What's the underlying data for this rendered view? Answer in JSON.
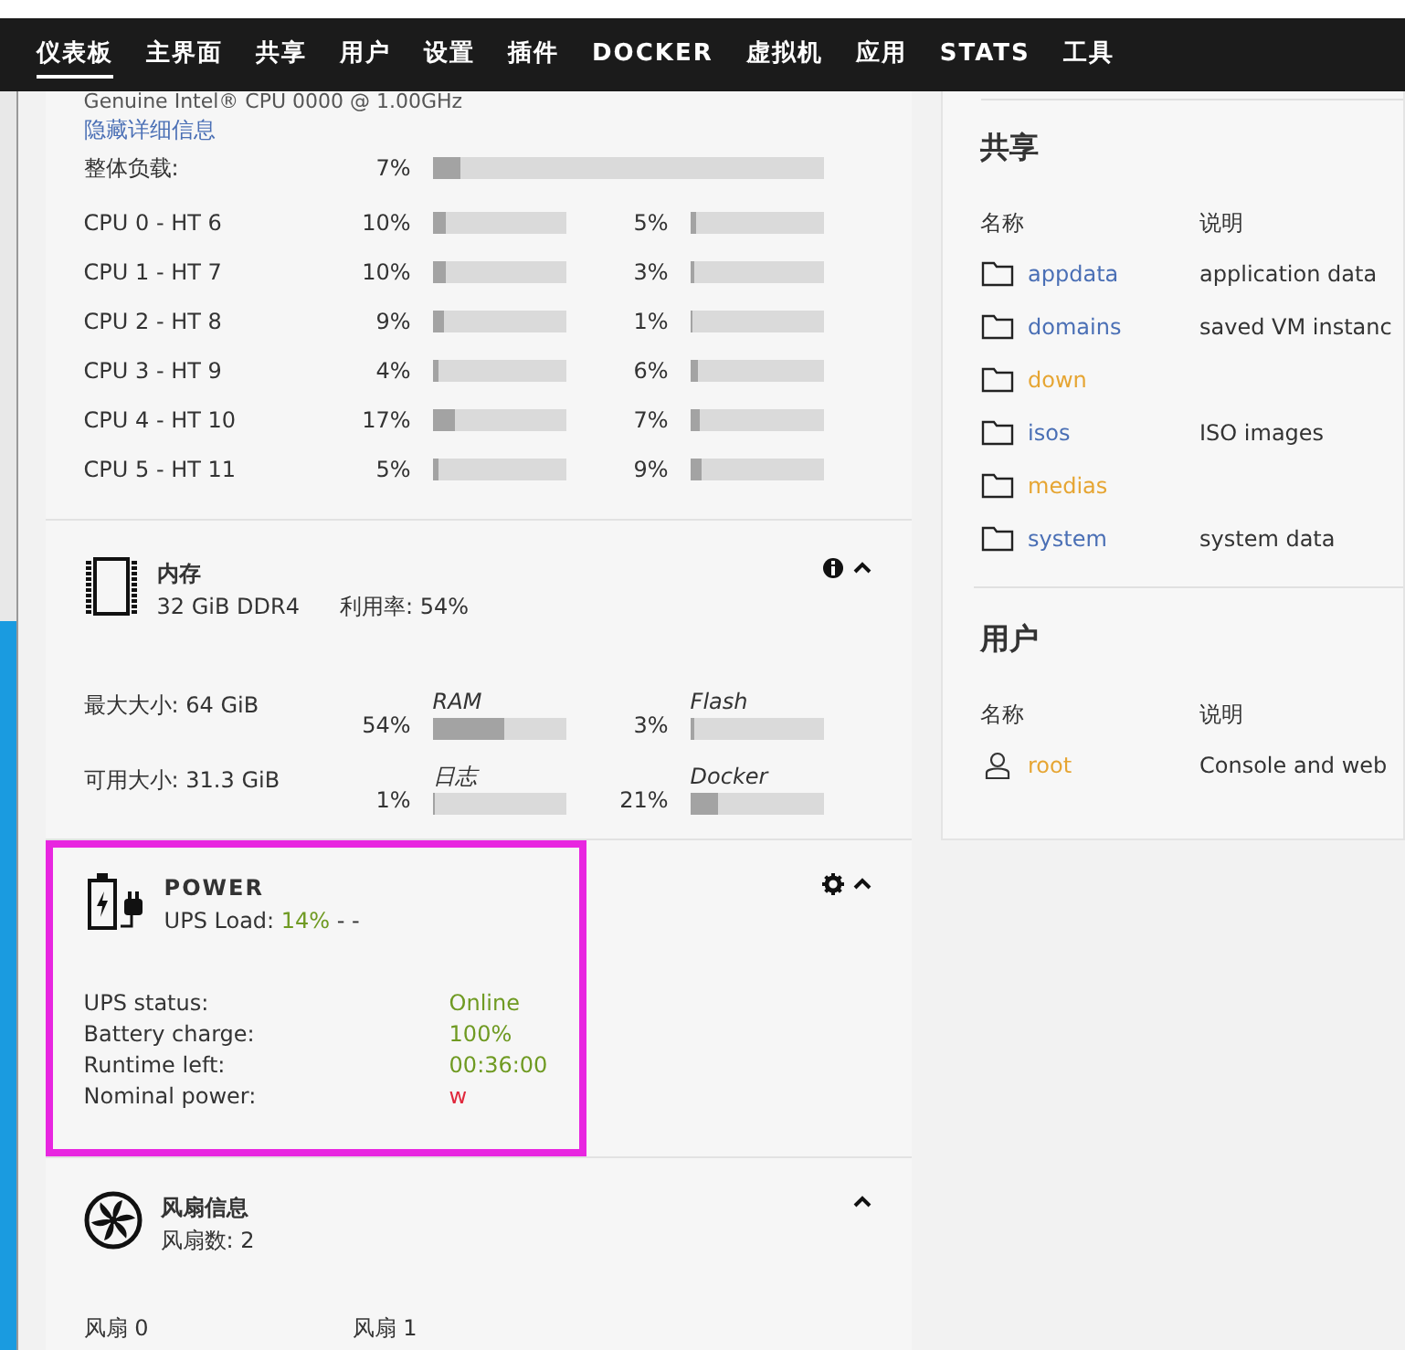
{
  "nav": [
    {
      "label": "仪表板",
      "selected": true
    },
    {
      "label": "主界面",
      "selected": false
    },
    {
      "label": "共享",
      "selected": false
    },
    {
      "label": "用户",
      "selected": false
    },
    {
      "label": "设置",
      "selected": false
    },
    {
      "label": "插件",
      "selected": false
    },
    {
      "label": "DOCKER",
      "selected": false
    },
    {
      "label": "虚拟机",
      "selected": false
    },
    {
      "label": "应用",
      "selected": false
    },
    {
      "label": "STATS",
      "selected": false
    },
    {
      "label": "工具",
      "selected": false
    }
  ],
  "cpu": {
    "model": "Genuine Intel® CPU 0000 @ 1.00GHz",
    "toggle_link": "隐藏详细信息",
    "overall": {
      "label": "整体负载:",
      "reading": "7%",
      "level": 0.07
    },
    "cores": [
      {
        "label": "CPU 0 - HT 6",
        "threads": [
          {
            "reading": "10%",
            "level": 0.1
          },
          {
            "reading": "5%",
            "level": 0.05
          }
        ]
      },
      {
        "label": "CPU 1 - HT 7",
        "threads": [
          {
            "reading": "10%",
            "level": 0.1
          },
          {
            "reading": "3%",
            "level": 0.03
          }
        ]
      },
      {
        "label": "CPU 2 - HT 8",
        "threads": [
          {
            "reading": "9%",
            "level": 0.09
          },
          {
            "reading": "1%",
            "level": 0.01
          }
        ]
      },
      {
        "label": "CPU 3 - HT 9",
        "threads": [
          {
            "reading": "4%",
            "level": 0.04
          },
          {
            "reading": "6%",
            "level": 0.06
          }
        ]
      },
      {
        "label": "CPU 4 - HT 10",
        "threads": [
          {
            "reading": "17%",
            "level": 0.17
          },
          {
            "reading": "7%",
            "level": 0.07
          }
        ]
      },
      {
        "label": "CPU 5 - HT 11",
        "threads": [
          {
            "reading": "5%",
            "level": 0.05
          },
          {
            "reading": "9%",
            "level": 0.09
          }
        ]
      }
    ]
  },
  "memory": {
    "title": "内存",
    "capacity": "32 GiB DDR4",
    "usage": "利用率: 54%",
    "rows": [
      {
        "label": "最大大小: 64 GiB",
        "bars": [
          {
            "name": "RAM",
            "reading": "54%",
            "level": 0.54
          },
          {
            "name": "Flash",
            "reading": "3%",
            "level": 0.03
          }
        ]
      },
      {
        "label": "可用大小: 31.3 GiB",
        "bars": [
          {
            "name": "日志",
            "reading": "1%",
            "level": 0.01
          },
          {
            "name": "Docker",
            "reading": "21%",
            "level": 0.21
          }
        ]
      }
    ]
  },
  "power": {
    "title": "POWER",
    "highlighted": true,
    "load_label": "UPS Load:",
    "load_value": "14%",
    "load_suffix": "- -",
    "details": [
      {
        "label": "UPS status:",
        "value": "Online",
        "color": "#6f9a22"
      },
      {
        "label": "Battery charge:",
        "value": "100%",
        "color": "#6f9a22"
      },
      {
        "label": "Runtime left:",
        "value": "00:36:00",
        "color": "#6f9a22"
      },
      {
        "label": "Nominal power:",
        "value": "w",
        "color": "#e0283c"
      }
    ]
  },
  "fans": {
    "title": "风扇信息",
    "count": "风扇数: 2",
    "items": [
      "风扇 0",
      "风扇 1"
    ]
  },
  "shares": {
    "title": "共享",
    "columns": [
      "名称",
      "说明"
    ],
    "rows": [
      {
        "name": "appdata",
        "description": "application data",
        "color": "#4a6fb5"
      },
      {
        "name": "domains",
        "description": "saved VM instanc",
        "color": "#4a6fb5"
      },
      {
        "name": "down",
        "color": "#e6a532"
      },
      {
        "name": "isos",
        "description": "ISO images",
        "color": "#4a6fb5"
      },
      {
        "name": "medias",
        "color": "#e6a532"
      },
      {
        "name": "system",
        "description": "system data",
        "color": "#4a6fb5"
      }
    ]
  },
  "users": {
    "title": "用户",
    "columns": [
      "名称",
      "说明"
    ],
    "rows": [
      {
        "name": "root",
        "description": "Console and web",
        "color": "#e6a532"
      }
    ]
  }
}
